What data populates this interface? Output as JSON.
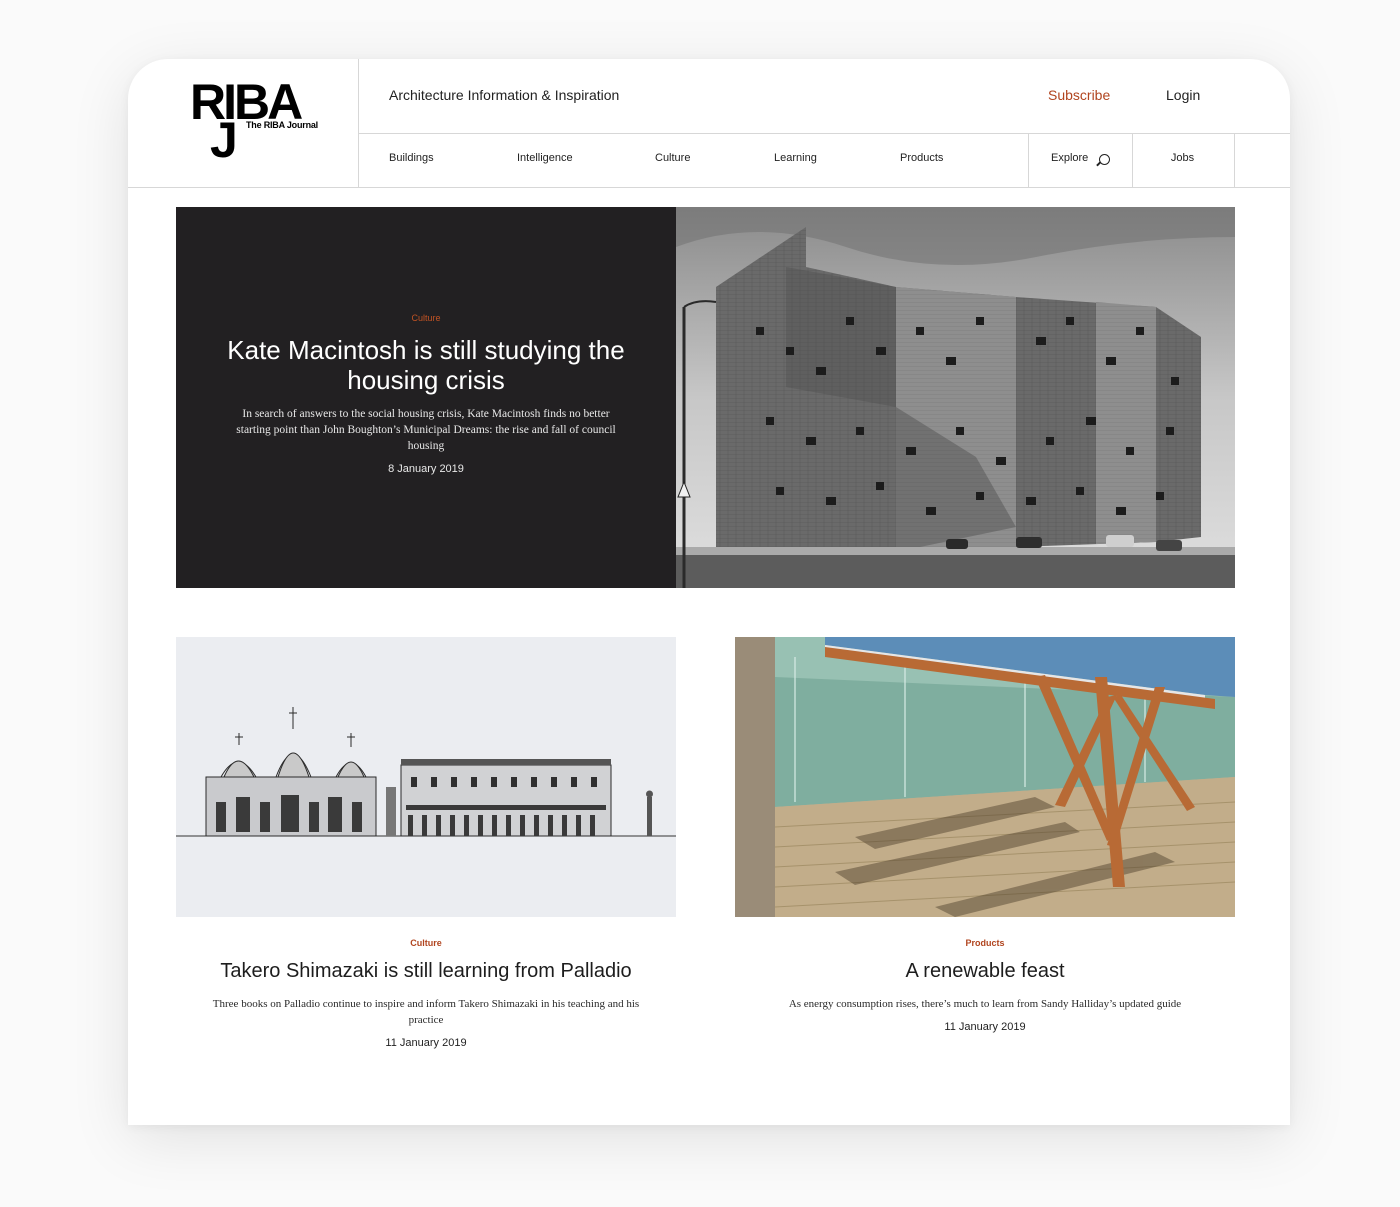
{
  "header": {
    "tagline": "Architecture Information & Inspiration",
    "subscribe": "Subscribe",
    "login": "Login",
    "logo": {
      "main": "RIBA",
      "j": "J",
      "sub": "The RIBA Journal"
    },
    "nav": [
      "Buildings",
      "Intelligence",
      "Culture",
      "Learning",
      "Products"
    ],
    "explore": "Explore",
    "jobs": "Jobs"
  },
  "hero": {
    "category": "Culture",
    "title": "Kate Macintosh is still studying the housing crisis",
    "description": "In search of answers to the social housing crisis, Kate Macintosh finds no better starting point than John Boughton’s Municipal Dreams: the rise and fall of council housing",
    "date": "8 January 2019"
  },
  "articles": [
    {
      "category": "Culture",
      "title": "Takero Shimazaki is still learning from Palladio",
      "description": "Three books on Palladio continue to inspire and inform Takero Shimazaki in his teaching and his practice",
      "date": "11 January 2019"
    },
    {
      "category": "Products",
      "title": "A renewable feast",
      "description": "As energy consumption rises, there’s much to learn from Sandy Halliday’s updated guide",
      "date": "11 January 2019"
    }
  ],
  "colors": {
    "accent": "#b1451f",
    "hero_bg": "#222022"
  }
}
